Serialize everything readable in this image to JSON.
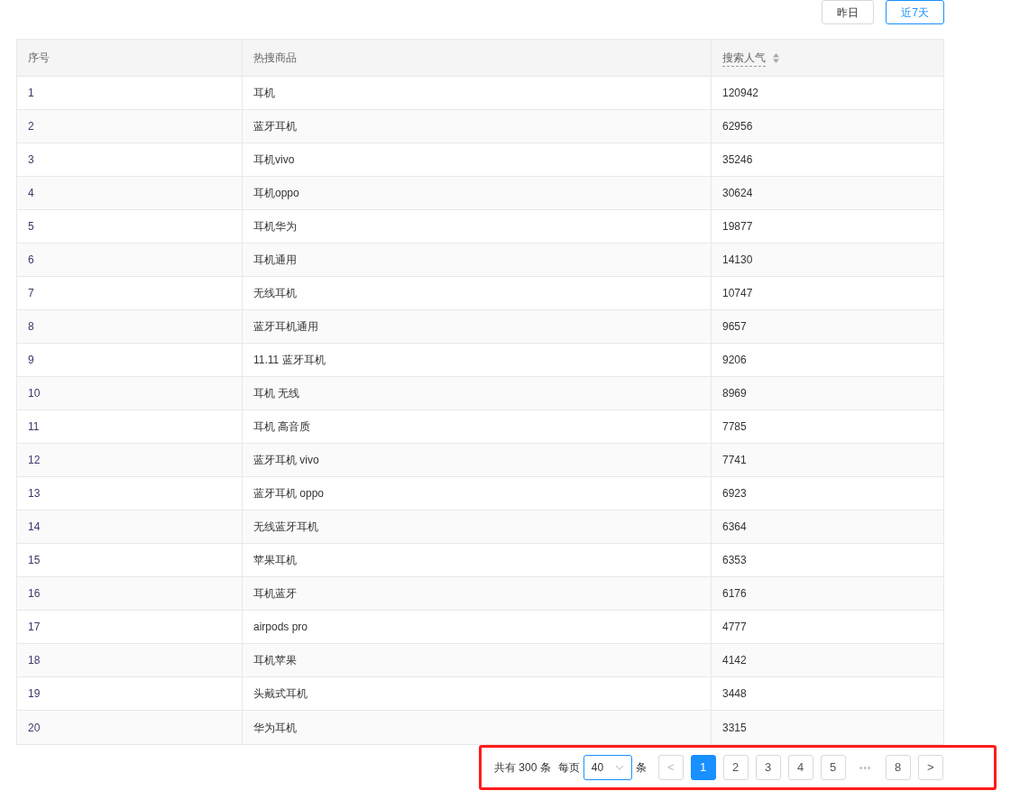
{
  "range_buttons": [
    {
      "label": "昨日",
      "selected": false
    },
    {
      "label": "近7天",
      "selected": true
    }
  ],
  "table": {
    "columns": [
      {
        "label": "序号",
        "sortable": false
      },
      {
        "label": "热搜商品",
        "sortable": false
      },
      {
        "label": "搜索人气",
        "sortable": true
      }
    ],
    "rows": [
      [
        "1",
        "耳机",
        "120942"
      ],
      [
        "2",
        "蓝牙耳机",
        "62956"
      ],
      [
        "3",
        "耳机vivo",
        "35246"
      ],
      [
        "4",
        "耳机oppo",
        "30624"
      ],
      [
        "5",
        "耳机华为",
        "19877"
      ],
      [
        "6",
        "耳机通用",
        "14130"
      ],
      [
        "7",
        "无线耳机",
        "10747"
      ],
      [
        "8",
        "蓝牙耳机通用",
        "9657"
      ],
      [
        "9",
        "11.11 蓝牙耳机",
        "9206"
      ],
      [
        "10",
        "耳机 无线",
        "8969"
      ],
      [
        "11",
        "耳机 高音质",
        "7785"
      ],
      [
        "12",
        "蓝牙耳机 vivo",
        "7741"
      ],
      [
        "13",
        "蓝牙耳机 oppo",
        "6923"
      ],
      [
        "14",
        "无线蓝牙耳机",
        "6364"
      ],
      [
        "15",
        "苹果耳机",
        "6353"
      ],
      [
        "16",
        "耳机蓝牙",
        "6176"
      ],
      [
        "17",
        "airpods pro",
        "4777"
      ],
      [
        "18",
        "耳机苹果",
        "4142"
      ],
      [
        "19",
        "头戴式耳机",
        "3448"
      ],
      [
        "20",
        "华为耳机",
        "3315"
      ]
    ]
  },
  "pagination": {
    "total_text": "共有 300 条",
    "per_page_label": "每页",
    "page_size": "40",
    "unit": "条",
    "prev": "<",
    "next": ">",
    "ellipsis": "•••",
    "pages": [
      {
        "label": "1",
        "selected": true
      },
      {
        "label": "2",
        "selected": false
      },
      {
        "label": "3",
        "selected": false
      },
      {
        "label": "4",
        "selected": false
      },
      {
        "label": "5",
        "selected": false
      },
      {
        "kind": "ellipsis"
      },
      {
        "label": "8",
        "selected": false
      }
    ]
  }
}
